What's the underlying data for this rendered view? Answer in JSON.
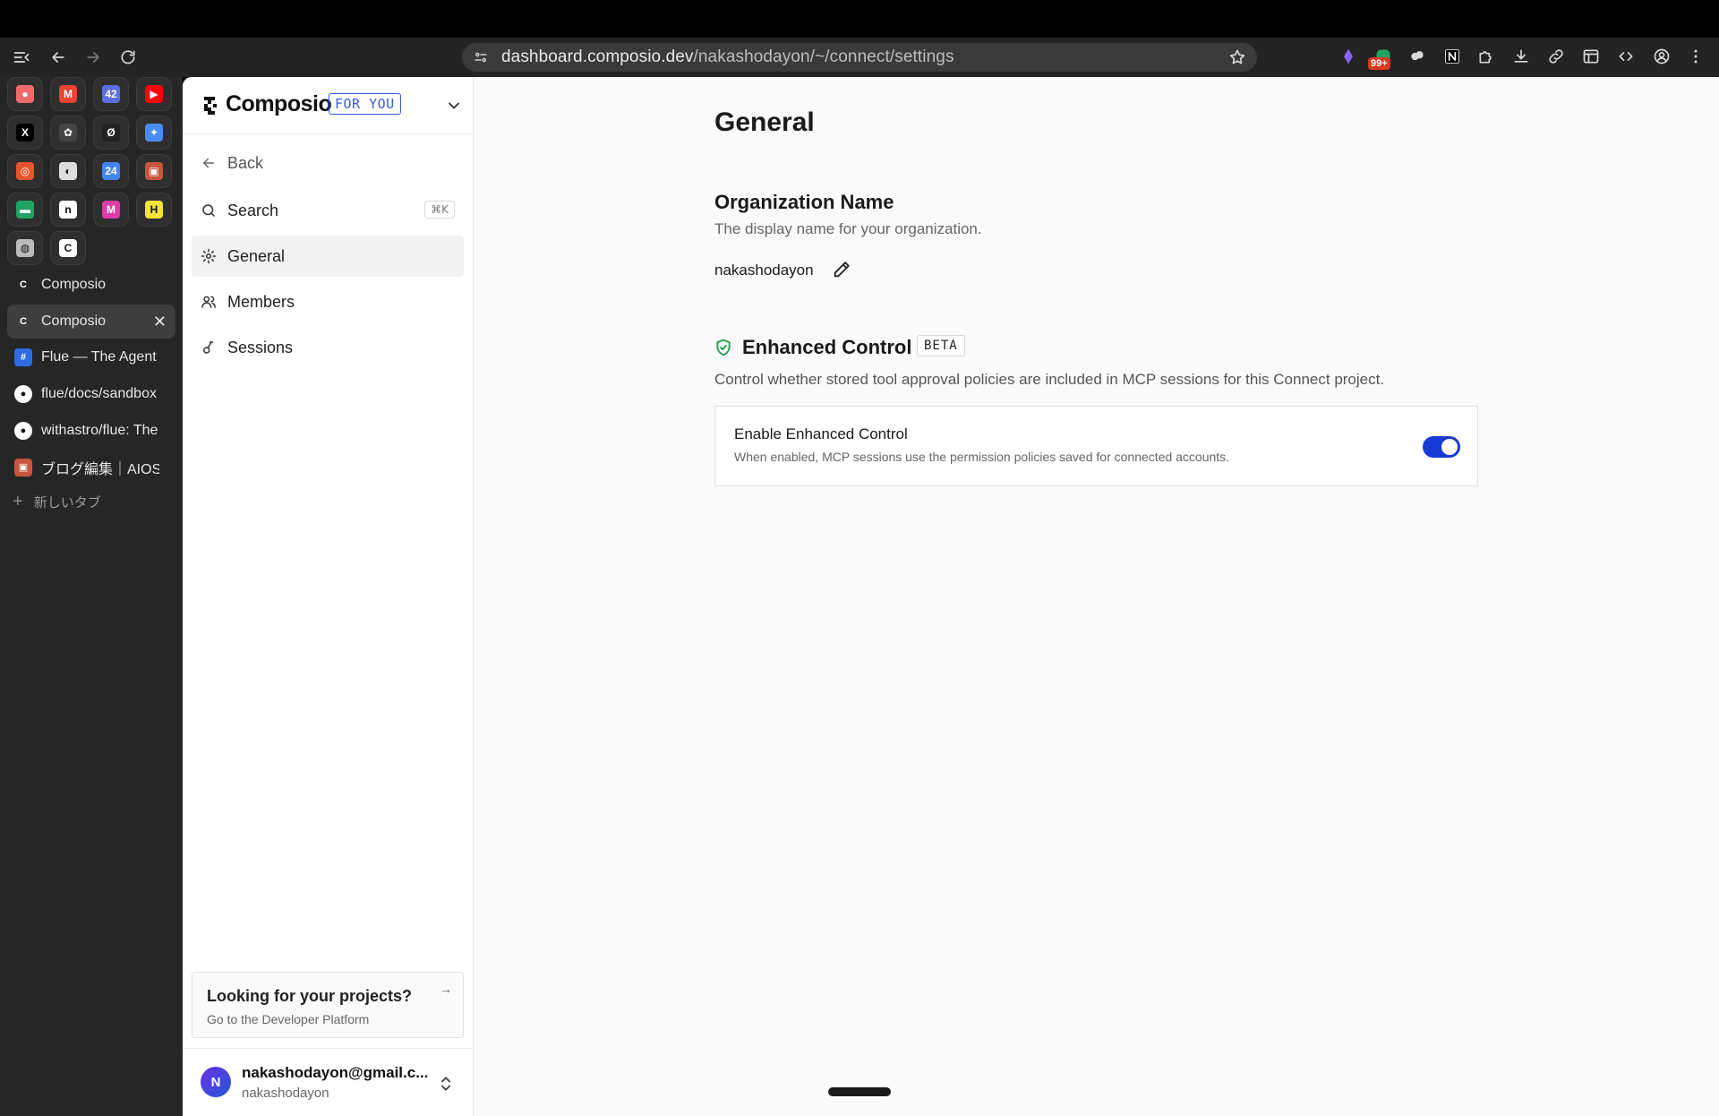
{
  "browser": {
    "url_host": "dashboard.composio.dev",
    "url_path": "/nakashodayon/~/connect/settings",
    "notification_badge": "99+"
  },
  "tabs": {
    "pinned": [
      {
        "icon": "asana-icon",
        "color": "#f06a6a",
        "glyph": "●"
      },
      {
        "icon": "gmail-icon",
        "color": "#ea4335",
        "glyph": "M"
      },
      {
        "icon": "calendar-count-icon",
        "color": "#5b6ee1",
        "glyph": "42"
      },
      {
        "icon": "youtube-icon",
        "color": "#ff0000",
        "glyph": "▶"
      },
      {
        "icon": "x-icon",
        "color": "#000000",
        "glyph": "X"
      },
      {
        "icon": "chatgpt-icon",
        "color": "#444444",
        "glyph": "✿"
      },
      {
        "icon": "perplexity-icon",
        "color": "#222222",
        "glyph": "Ø"
      },
      {
        "icon": "gemini-icon",
        "color": "#4a8cf7",
        "glyph": "✦"
      },
      {
        "icon": "ring-app-icon",
        "color": "#e8542c",
        "glyph": "◎"
      },
      {
        "icon": "linear-icon",
        "color": "#dddddd",
        "glyph": "◐"
      },
      {
        "icon": "google-calendar-icon",
        "color": "#4285f4",
        "glyph": "24"
      },
      {
        "icon": "profile-image-icon",
        "color": "#c8553d",
        "glyph": "▣"
      },
      {
        "icon": "meet-icon",
        "color": "#1fa463",
        "glyph": "▬"
      },
      {
        "icon": "notion-like-icon",
        "color": "#ffffff",
        "glyph": "n"
      },
      {
        "icon": "m-app-icon",
        "color": "#e03ca8",
        "glyph": "M"
      },
      {
        "icon": "h-app-icon",
        "color": "#f3e33b",
        "glyph": "H"
      },
      {
        "icon": "globe-icon",
        "color": "#bbbbbb",
        "glyph": "◍"
      },
      {
        "icon": "composio-icon",
        "color": "#ffffff",
        "glyph": "C"
      }
    ],
    "items": [
      {
        "label": "Composio",
        "icon": "composio-icon",
        "active": false
      },
      {
        "label": "Composio",
        "icon": "composio-icon",
        "active": true
      },
      {
        "label": "Flue — The Agent I",
        "icon": "flue-icon",
        "active": false
      },
      {
        "label": "flue/docs/sandbox",
        "icon": "github-icon",
        "active": false
      },
      {
        "label": "withastro/flue: The",
        "icon": "github-icon",
        "active": false
      },
      {
        "label": "ブログ編集｜AIOS",
        "icon": "profile-image-icon",
        "active": false
      }
    ],
    "new_tab_label": "新しいタブ",
    "close_glyph": "✕"
  },
  "sidebar": {
    "logo_text": "Composio",
    "badge": "FOR YOU",
    "back_label": "Back",
    "search_label": "Search",
    "search_shortcut": "⌘K",
    "nav": [
      {
        "label": "General",
        "icon": "gear-icon",
        "active": true
      },
      {
        "label": "Members",
        "icon": "users-icon",
        "active": false
      },
      {
        "label": "Sessions",
        "icon": "sessions-icon",
        "active": false
      }
    ],
    "projects_card": {
      "title": "Looking for your projects?",
      "subtitle": "Go to the Developer Platform"
    },
    "user": {
      "initial": "N",
      "email": "nakashodayon@gmail.c...",
      "name": "nakashodayon"
    }
  },
  "main": {
    "title": "General",
    "org_section": {
      "title": "Organization Name",
      "description": "The display name for your organization.",
      "value": "nakashodayon"
    },
    "enhanced_section": {
      "title": "Enhanced Control",
      "badge": "BETA",
      "description": "Control whether stored tool approval policies are included in MCP sessions for this Connect project.",
      "card_title": "Enable Enhanced Control",
      "card_desc": "When enabled, MCP sessions use the permission policies saved for connected accounts.",
      "enabled": true
    }
  },
  "colors": {
    "accent_blue": "#1a3ad6",
    "shield_green": "#1f9d48",
    "badge_blue": "#3b5bd9"
  }
}
